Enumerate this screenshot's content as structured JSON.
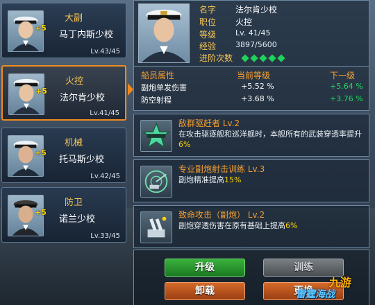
{
  "officers": [
    {
      "role": "大副",
      "name": "马丁内斯少校",
      "bonus": "+5",
      "level": "Lv.43/45",
      "selected": false
    },
    {
      "role": "火控",
      "name": "法尔肯少校",
      "bonus": "+5",
      "level": "Lv.41/45",
      "selected": true
    },
    {
      "role": "机械",
      "name": "托马斯少校",
      "bonus": "+5",
      "level": "Lv.42/45",
      "selected": false
    },
    {
      "role": "防卫",
      "name": "诺兰少校",
      "bonus": "+5",
      "level": "Lv.33/45",
      "selected": false
    }
  ],
  "detail": {
    "name_key": "名字",
    "name_val": "法尔肯少校",
    "post_key": "职位",
    "post_val": "火控",
    "level_key": "等级",
    "level_val": "Lv. 41/45",
    "exp_key": "经验",
    "exp_val": "3897/5600",
    "advance_key": "进阶次数",
    "advance_count": 5
  },
  "attributes": {
    "head_name": "船员属性",
    "head_current": "当前等级",
    "head_next": "下一级",
    "rows": [
      {
        "name": "副炮单发伤害",
        "current": "+5.52 %",
        "next": "+5.64 %"
      },
      {
        "name": "防空射程",
        "current": "+3.68 %",
        "next": "+3.76 %"
      }
    ]
  },
  "skills": [
    {
      "title": "敌群驱赶者 Lv.2",
      "desc": "在攻击驱逐舰和巡洋舰时，本舰所有的武装穿透率提升",
      "value": "6%",
      "icon": "star-badge-icon"
    },
    {
      "title": "专业副炮射击训练 Lv.3",
      "desc": "副炮精准提高",
      "value": "15%",
      "icon": "radar-gun-icon"
    },
    {
      "title": "致命攻击（副炮） Lv.2",
      "desc": "副炮穿透伤害在原有基础上提高",
      "value": "6%",
      "icon": "artillery-icon"
    }
  ],
  "buttons": {
    "upgrade": "升级",
    "unload": "卸载",
    "train": "训练",
    "replace": "更换"
  },
  "watermark": {
    "logo": "九游",
    "game": "雷霆海战"
  },
  "colors": {
    "accent_orange": "#f08a1e",
    "label_gold": "#f6c453",
    "positive_green": "#22d860",
    "button_green": "#2e9a32",
    "button_orange": "#c05a22"
  }
}
